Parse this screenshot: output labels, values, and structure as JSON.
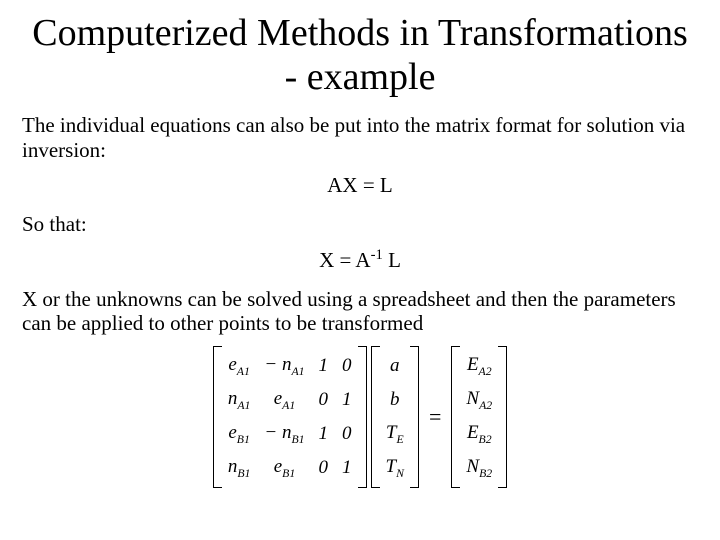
{
  "title": "Computerized Methods in Transformations - example",
  "para1": "The individual equations can also be put into the matrix format for solution via inversion:",
  "eq1": "AX = L",
  "so_that": "So that:",
  "eq2_pre": "X = A",
  "eq2_sup": "-1",
  "eq2_post": " L",
  "para2": "X or the unknowns can be solved using a spreadsheet and then the parameters can be applied to other points to be transformed",
  "matrix": {
    "A": [
      [
        "e",
        "A1",
        "− n",
        "A1",
        "1",
        "0"
      ],
      [
        "n",
        "A1",
        "e",
        "A1",
        "0",
        "1"
      ],
      [
        "e",
        "B1",
        "− n",
        "B1",
        "1",
        "0"
      ],
      [
        "n",
        "B1",
        "e",
        "B1",
        "0",
        "1"
      ]
    ],
    "X": [
      [
        "a"
      ],
      [
        "b"
      ],
      [
        "T",
        "E"
      ],
      [
        "T",
        "N"
      ]
    ],
    "eq": "=",
    "L": [
      [
        "E",
        "A2"
      ],
      [
        "N",
        "A2"
      ],
      [
        "E",
        "B2"
      ],
      [
        "N",
        "B2"
      ]
    ]
  }
}
